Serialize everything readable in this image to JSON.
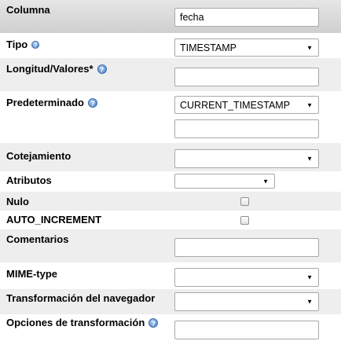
{
  "header": {
    "column_label": "Columna",
    "column_value": "fecha"
  },
  "fields": {
    "type": {
      "label": "Tipo",
      "value": "TIMESTAMP"
    },
    "length": {
      "label": "Longitud/Valores*",
      "value": ""
    },
    "default": {
      "label": "Predeterminado",
      "value": "CURRENT_TIMESTAMP",
      "extra_value": ""
    },
    "collation": {
      "label": "Cotejamiento",
      "value": ""
    },
    "attributes": {
      "label": "Atributos",
      "value": ""
    },
    "null": {
      "label": "Nulo",
      "checked": false
    },
    "auto_increment": {
      "label": "AUTO_INCREMENT",
      "checked": false
    },
    "comments": {
      "label": "Comentarios",
      "value": ""
    },
    "mime_type": {
      "label": "MIME-type",
      "value": ""
    },
    "browser_transformation": {
      "label": "Transformación del navegador",
      "value": ""
    },
    "transformation_options": {
      "label": "Opciones de transformación",
      "value": ""
    }
  },
  "icons": {
    "help": "help-icon",
    "dropdown": "chevron-down-icon"
  },
  "colors": {
    "row_alt": "#eeeeee",
    "help_icon": "#4a7fc4"
  }
}
